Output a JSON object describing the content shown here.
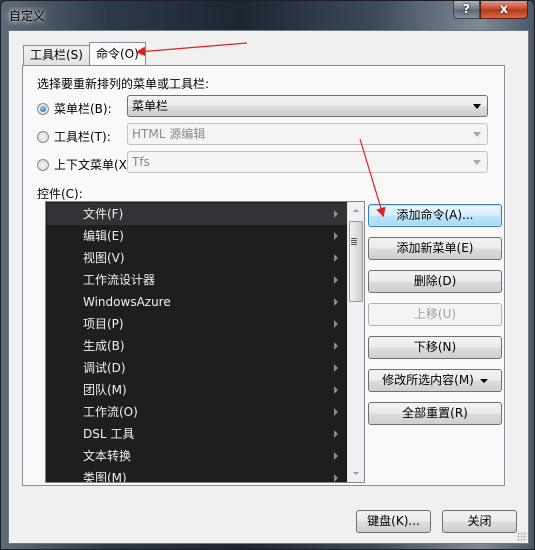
{
  "window": {
    "title": "自定义",
    "help_button": "?",
    "close_button": "x"
  },
  "tabs": [
    {
      "label": "工具栏(S)",
      "active": false
    },
    {
      "label": "命令(O)",
      "active": true
    }
  ],
  "panel": {
    "choose_label": "选择要重新排列的菜单或工具栏:",
    "options": [
      {
        "label": "菜单栏(B):",
        "checked": true,
        "combo_value": "菜单栏",
        "enabled": true
      },
      {
        "label": "工具栏(T):",
        "checked": false,
        "combo_value": "HTML 源编辑",
        "enabled": false
      },
      {
        "label": "上下文菜单(X):",
        "checked": false,
        "combo_value": "Tfs",
        "enabled": false
      }
    ],
    "controls_label": "控件(C):",
    "controls": [
      {
        "label": "文件(F)",
        "selected": true,
        "has_submenu": true
      },
      {
        "label": "编辑(E)",
        "selected": false,
        "has_submenu": true
      },
      {
        "label": "视图(V)",
        "selected": false,
        "has_submenu": true
      },
      {
        "label": "工作流设计器",
        "selected": false,
        "has_submenu": true
      },
      {
        "label": "WindowsAzure",
        "selected": false,
        "has_submenu": true
      },
      {
        "label": "项目(P)",
        "selected": false,
        "has_submenu": true
      },
      {
        "label": "生成(B)",
        "selected": false,
        "has_submenu": true
      },
      {
        "label": "调试(D)",
        "selected": false,
        "has_submenu": true
      },
      {
        "label": "团队(M)",
        "selected": false,
        "has_submenu": true
      },
      {
        "label": "工作流(O)",
        "selected": false,
        "has_submenu": true
      },
      {
        "label": "DSL 工具",
        "selected": false,
        "has_submenu": true
      },
      {
        "label": "文本转换",
        "selected": false,
        "has_submenu": true
      },
      {
        "label": "类图(M)",
        "selected": false,
        "has_submenu": true
      }
    ],
    "buttons": {
      "add_command": "添加命令(A)...",
      "add_new_menu": "添加新菜单(E)",
      "delete": "删除(D)",
      "move_up": "上移(U)",
      "move_down": "下移(N)",
      "modify_selection": "修改所选内容(M)",
      "reset_all": "全部重置(R)"
    }
  },
  "footer": {
    "keyboard": "键盘(K)...",
    "close": "关闭"
  },
  "annotations": {
    "arrow_color": "#e02020"
  }
}
